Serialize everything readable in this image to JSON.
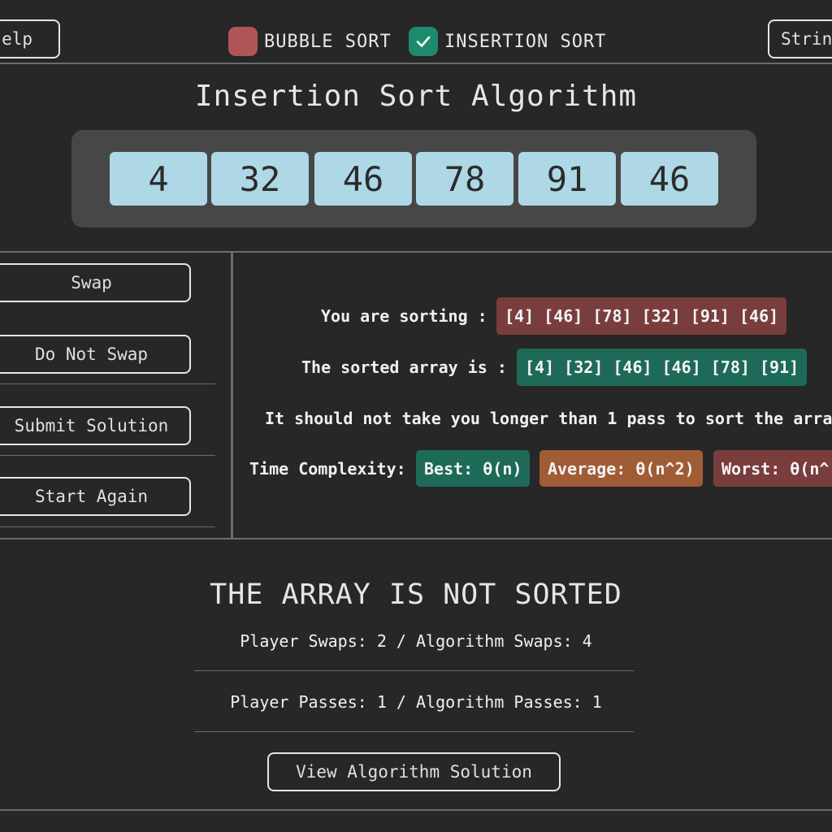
{
  "header": {
    "help_label": "elp",
    "strings_label": "Strin",
    "toggles": [
      {
        "label": "BUBBLE SORT",
        "checked": false,
        "color": "#b05458"
      },
      {
        "label": "INSERTION SORT",
        "checked": true,
        "color": "#1e8a6e",
        "icon": "check-icon"
      }
    ]
  },
  "main": {
    "title": "Insertion Sort Algorithm",
    "array": [
      "4",
      "32",
      "46",
      "78",
      "91",
      "46"
    ]
  },
  "controls": {
    "swap": "Swap",
    "do_not_swap": "Do Not Swap",
    "submit": "Submit Solution",
    "start_again": "Start Again"
  },
  "info": {
    "sorting_label": "You are sorting :",
    "sorting_value": "[4] [46] [78] [32] [91] [46]",
    "sorted_label": "The sorted array is :",
    "sorted_value": "[4] [32] [46] [46] [78] [91]",
    "passes_note": "It should not take you longer than 1 pass to sort the arra",
    "complexity_label": "Time Complexity:",
    "best": "Best: θ(n)",
    "average": "Average: θ(n^2)",
    "worst": "Worst: θ(n^",
    "colors": {
      "red": "#7a3d3d",
      "green": "#1e6a59",
      "orange": "#a05c34"
    }
  },
  "result": {
    "status": "THE ARRAY IS NOT SORTED",
    "swaps": "Player Swaps: 2 / Algorithm Swaps: 4",
    "passes": "Player Passes: 1 / Algorithm Passes: 1",
    "view_solution": "View Algorithm Solution"
  }
}
